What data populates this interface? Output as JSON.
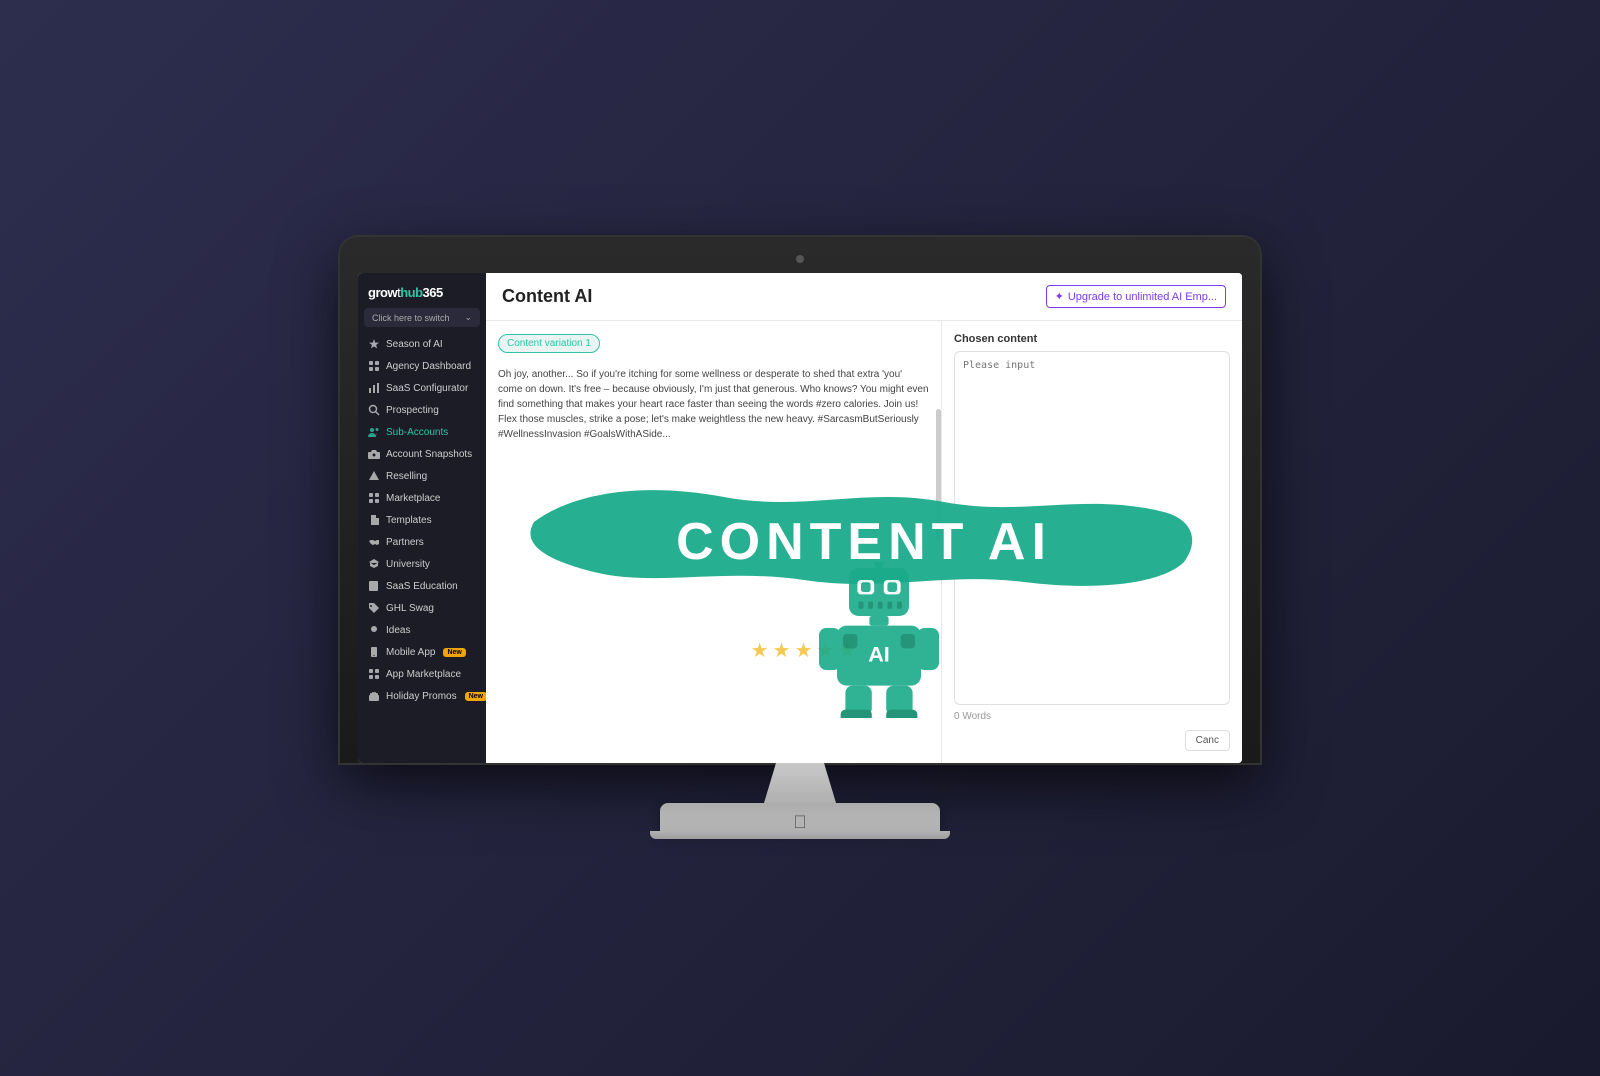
{
  "app": {
    "name": "growthhub365",
    "name_parts": {
      "grow": "grow",
      "hub": "hub",
      "num": "365"
    }
  },
  "header": {
    "title": "Content AI",
    "upgrade_label": "Upgrade to unlimited AI Emp..."
  },
  "sidebar": {
    "switch_label": "Click here to switch",
    "items": [
      {
        "id": "season-ai",
        "label": "Season of AI",
        "icon": "star"
      },
      {
        "id": "agency-dashboard",
        "label": "Agency Dashboard",
        "icon": "grid"
      },
      {
        "id": "saas-configurator",
        "label": "SaaS Configurator",
        "icon": "bar-chart"
      },
      {
        "id": "prospecting",
        "label": "Prospecting",
        "icon": "search"
      },
      {
        "id": "sub-accounts",
        "label": "Sub-Accounts",
        "icon": "users",
        "active": true
      },
      {
        "id": "account-snapshots",
        "label": "Account Snapshots",
        "icon": "camera"
      },
      {
        "id": "reselling",
        "label": "Reselling",
        "icon": "triangle"
      },
      {
        "id": "marketplace",
        "label": "Marketplace",
        "icon": "grid"
      },
      {
        "id": "templates",
        "label": "Templates",
        "icon": "file"
      },
      {
        "id": "partners",
        "label": "Partners",
        "icon": "handshake"
      },
      {
        "id": "university",
        "label": "University",
        "icon": "graduation"
      },
      {
        "id": "saas-education",
        "label": "SaaS Education",
        "icon": "book"
      },
      {
        "id": "ghl-swag",
        "label": "GHL Swag",
        "icon": "tag"
      },
      {
        "id": "ideas",
        "label": "Ideas",
        "icon": "bulb"
      },
      {
        "id": "mobile-app",
        "label": "Mobile App",
        "icon": "mobile",
        "badge": "New"
      },
      {
        "id": "app-marketplace",
        "label": "App Marketplace",
        "icon": "grid"
      },
      {
        "id": "holiday-promos",
        "label": "Holiday Promos",
        "icon": "gift",
        "badge": "New"
      }
    ]
  },
  "content": {
    "variation_label": "Content variation 1",
    "body_text": "Oh joy, another... So if you're itching for some wellness or desperate to shed that extra 'you' come on down. It's free – because obviously, I'm just that generous. Who knows? You might even find something that makes your heart race faster than seeing the words #zero calories. Join us! Flex those muscles, strike a pose; let's make weightless the new heavy. #SarcasmButSeriously #WellnessInvasion #GoalsWithASide...",
    "chosen_content_label": "Chosen content",
    "placeholder": "Please input",
    "word_count": "0 Words",
    "cancel_label": "Canc"
  },
  "overlay": {
    "text": "CONTENT AI"
  },
  "colors": {
    "teal": "#1aab8a",
    "purple": "#7c3aed",
    "sidebar_bg": "#1c1c27",
    "badge_yellow": "#f0a500"
  }
}
